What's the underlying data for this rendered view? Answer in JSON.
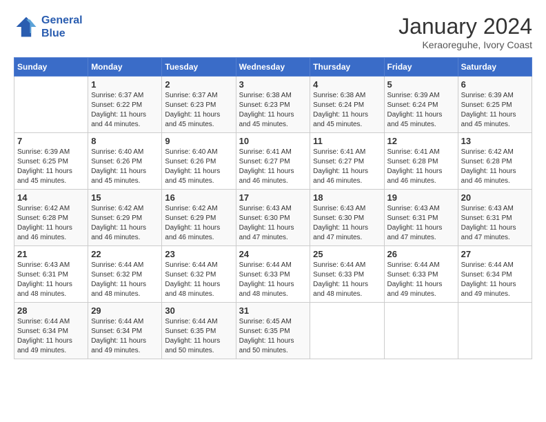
{
  "header": {
    "logo_line1": "General",
    "logo_line2": "Blue",
    "month": "January 2024",
    "location": "Keraoreguhe, Ivory Coast"
  },
  "days_of_week": [
    "Sunday",
    "Monday",
    "Tuesday",
    "Wednesday",
    "Thursday",
    "Friday",
    "Saturday"
  ],
  "weeks": [
    [
      {
        "num": "",
        "sunrise": "",
        "sunset": "",
        "daylight": ""
      },
      {
        "num": "1",
        "sunrise": "Sunrise: 6:37 AM",
        "sunset": "Sunset: 6:22 PM",
        "daylight": "Daylight: 11 hours and 44 minutes."
      },
      {
        "num": "2",
        "sunrise": "Sunrise: 6:37 AM",
        "sunset": "Sunset: 6:23 PM",
        "daylight": "Daylight: 11 hours and 45 minutes."
      },
      {
        "num": "3",
        "sunrise": "Sunrise: 6:38 AM",
        "sunset": "Sunset: 6:23 PM",
        "daylight": "Daylight: 11 hours and 45 minutes."
      },
      {
        "num": "4",
        "sunrise": "Sunrise: 6:38 AM",
        "sunset": "Sunset: 6:24 PM",
        "daylight": "Daylight: 11 hours and 45 minutes."
      },
      {
        "num": "5",
        "sunrise": "Sunrise: 6:39 AM",
        "sunset": "Sunset: 6:24 PM",
        "daylight": "Daylight: 11 hours and 45 minutes."
      },
      {
        "num": "6",
        "sunrise": "Sunrise: 6:39 AM",
        "sunset": "Sunset: 6:25 PM",
        "daylight": "Daylight: 11 hours and 45 minutes."
      }
    ],
    [
      {
        "num": "7",
        "sunrise": "Sunrise: 6:39 AM",
        "sunset": "Sunset: 6:25 PM",
        "daylight": "Daylight: 11 hours and 45 minutes."
      },
      {
        "num": "8",
        "sunrise": "Sunrise: 6:40 AM",
        "sunset": "Sunset: 6:26 PM",
        "daylight": "Daylight: 11 hours and 45 minutes."
      },
      {
        "num": "9",
        "sunrise": "Sunrise: 6:40 AM",
        "sunset": "Sunset: 6:26 PM",
        "daylight": "Daylight: 11 hours and 45 minutes."
      },
      {
        "num": "10",
        "sunrise": "Sunrise: 6:41 AM",
        "sunset": "Sunset: 6:27 PM",
        "daylight": "Daylight: 11 hours and 46 minutes."
      },
      {
        "num": "11",
        "sunrise": "Sunrise: 6:41 AM",
        "sunset": "Sunset: 6:27 PM",
        "daylight": "Daylight: 11 hours and 46 minutes."
      },
      {
        "num": "12",
        "sunrise": "Sunrise: 6:41 AM",
        "sunset": "Sunset: 6:28 PM",
        "daylight": "Daylight: 11 hours and 46 minutes."
      },
      {
        "num": "13",
        "sunrise": "Sunrise: 6:42 AM",
        "sunset": "Sunset: 6:28 PM",
        "daylight": "Daylight: 11 hours and 46 minutes."
      }
    ],
    [
      {
        "num": "14",
        "sunrise": "Sunrise: 6:42 AM",
        "sunset": "Sunset: 6:28 PM",
        "daylight": "Daylight: 11 hours and 46 minutes."
      },
      {
        "num": "15",
        "sunrise": "Sunrise: 6:42 AM",
        "sunset": "Sunset: 6:29 PM",
        "daylight": "Daylight: 11 hours and 46 minutes."
      },
      {
        "num": "16",
        "sunrise": "Sunrise: 6:42 AM",
        "sunset": "Sunset: 6:29 PM",
        "daylight": "Daylight: 11 hours and 46 minutes."
      },
      {
        "num": "17",
        "sunrise": "Sunrise: 6:43 AM",
        "sunset": "Sunset: 6:30 PM",
        "daylight": "Daylight: 11 hours and 47 minutes."
      },
      {
        "num": "18",
        "sunrise": "Sunrise: 6:43 AM",
        "sunset": "Sunset: 6:30 PM",
        "daylight": "Daylight: 11 hours and 47 minutes."
      },
      {
        "num": "19",
        "sunrise": "Sunrise: 6:43 AM",
        "sunset": "Sunset: 6:31 PM",
        "daylight": "Daylight: 11 hours and 47 minutes."
      },
      {
        "num": "20",
        "sunrise": "Sunrise: 6:43 AM",
        "sunset": "Sunset: 6:31 PM",
        "daylight": "Daylight: 11 hours and 47 minutes."
      }
    ],
    [
      {
        "num": "21",
        "sunrise": "Sunrise: 6:43 AM",
        "sunset": "Sunset: 6:31 PM",
        "daylight": "Daylight: 11 hours and 48 minutes."
      },
      {
        "num": "22",
        "sunrise": "Sunrise: 6:44 AM",
        "sunset": "Sunset: 6:32 PM",
        "daylight": "Daylight: 11 hours and 48 minutes."
      },
      {
        "num": "23",
        "sunrise": "Sunrise: 6:44 AM",
        "sunset": "Sunset: 6:32 PM",
        "daylight": "Daylight: 11 hours and 48 minutes."
      },
      {
        "num": "24",
        "sunrise": "Sunrise: 6:44 AM",
        "sunset": "Sunset: 6:33 PM",
        "daylight": "Daylight: 11 hours and 48 minutes."
      },
      {
        "num": "25",
        "sunrise": "Sunrise: 6:44 AM",
        "sunset": "Sunset: 6:33 PM",
        "daylight": "Daylight: 11 hours and 48 minutes."
      },
      {
        "num": "26",
        "sunrise": "Sunrise: 6:44 AM",
        "sunset": "Sunset: 6:33 PM",
        "daylight": "Daylight: 11 hours and 49 minutes."
      },
      {
        "num": "27",
        "sunrise": "Sunrise: 6:44 AM",
        "sunset": "Sunset: 6:34 PM",
        "daylight": "Daylight: 11 hours and 49 minutes."
      }
    ],
    [
      {
        "num": "28",
        "sunrise": "Sunrise: 6:44 AM",
        "sunset": "Sunset: 6:34 PM",
        "daylight": "Daylight: 11 hours and 49 minutes."
      },
      {
        "num": "29",
        "sunrise": "Sunrise: 6:44 AM",
        "sunset": "Sunset: 6:34 PM",
        "daylight": "Daylight: 11 hours and 49 minutes."
      },
      {
        "num": "30",
        "sunrise": "Sunrise: 6:44 AM",
        "sunset": "Sunset: 6:35 PM",
        "daylight": "Daylight: 11 hours and 50 minutes."
      },
      {
        "num": "31",
        "sunrise": "Sunrise: 6:45 AM",
        "sunset": "Sunset: 6:35 PM",
        "daylight": "Daylight: 11 hours and 50 minutes."
      },
      {
        "num": "",
        "sunrise": "",
        "sunset": "",
        "daylight": ""
      },
      {
        "num": "",
        "sunrise": "",
        "sunset": "",
        "daylight": ""
      },
      {
        "num": "",
        "sunrise": "",
        "sunset": "",
        "daylight": ""
      }
    ]
  ]
}
